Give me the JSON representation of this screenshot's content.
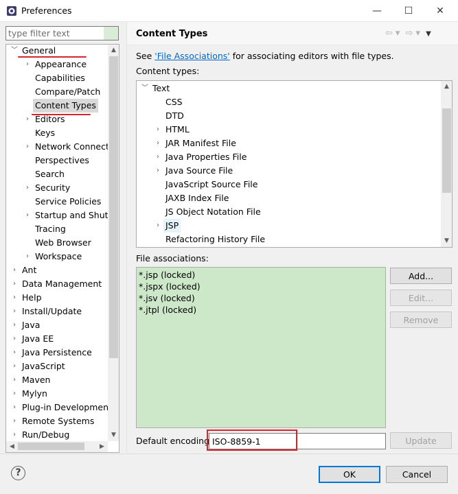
{
  "window": {
    "title": "Preferences",
    "min_glyph": "—",
    "max_glyph": "☐",
    "close_glyph": "✕"
  },
  "filter": {
    "placeholder": "type filter text"
  },
  "tree": {
    "items": [
      {
        "label": "General",
        "chevron": "﹀"
      },
      {
        "label": "Appearance",
        "chevron": "›"
      },
      {
        "label": "Capabilities"
      },
      {
        "label": "Compare/Patch"
      },
      {
        "label": "Content Types"
      },
      {
        "label": "Editors",
        "chevron": "›"
      },
      {
        "label": "Keys"
      },
      {
        "label": "Network Connectio",
        "chevron": "›"
      },
      {
        "label": "Perspectives"
      },
      {
        "label": "Search"
      },
      {
        "label": "Security",
        "chevron": "›"
      },
      {
        "label": "Service Policies"
      },
      {
        "label": "Startup and Shutd",
        "chevron": "›"
      },
      {
        "label": "Tracing"
      },
      {
        "label": "Web Browser"
      },
      {
        "label": "Workspace",
        "chevron": "›"
      },
      {
        "label": "Ant",
        "chevron": "›"
      },
      {
        "label": "Data Management",
        "chevron": "›"
      },
      {
        "label": "Help",
        "chevron": "›"
      },
      {
        "label": "Install/Update",
        "chevron": "›"
      },
      {
        "label": "Java",
        "chevron": "›"
      },
      {
        "label": "Java EE",
        "chevron": "›"
      },
      {
        "label": "Java Persistence",
        "chevron": "›"
      },
      {
        "label": "JavaScript",
        "chevron": "›"
      },
      {
        "label": "Maven",
        "chevron": "›"
      },
      {
        "label": "Mylyn",
        "chevron": "›"
      },
      {
        "label": "Plug-in Development",
        "chevron": "›"
      },
      {
        "label": "Remote Systems",
        "chevron": "›"
      },
      {
        "label": "Run/Debug",
        "chevron": "›"
      }
    ]
  },
  "page": {
    "title": "Content Types",
    "nav_back": "⇦",
    "nav_forward": "⇨",
    "nav_dropdown": "▾",
    "nav_menu": "▼"
  },
  "see": {
    "prefix": "See ",
    "link": "'File Associations'",
    "suffix": " for associating editors with file types."
  },
  "content_types": {
    "label": "Content types:",
    "items": [
      {
        "label": "Text",
        "chevron": "﹀"
      },
      {
        "label": "CSS"
      },
      {
        "label": "DTD"
      },
      {
        "label": "HTML",
        "chevron": "›"
      },
      {
        "label": "JAR Manifest File",
        "chevron": "›"
      },
      {
        "label": "Java Properties File",
        "chevron": "›"
      },
      {
        "label": "Java Source File",
        "chevron": "›"
      },
      {
        "label": "JavaScript Source File"
      },
      {
        "label": "JAXB Index File"
      },
      {
        "label": "JS Object Notation File"
      },
      {
        "label": "JSP",
        "chevron": "›"
      },
      {
        "label": "Refactoring History File"
      }
    ]
  },
  "file_associations": {
    "label": "File associations:",
    "items": [
      "*.jsp (locked)",
      "*.jspx (locked)",
      "*.jsv (locked)",
      "*.jtpl (locked)"
    ],
    "add": "Add...",
    "edit": "Edit...",
    "remove": "Remove"
  },
  "encoding": {
    "label": "Default encoding:",
    "value": "ISO-8859-1",
    "update": "Update"
  },
  "footer": {
    "help_glyph": "?",
    "ok": "OK",
    "cancel": "Cancel"
  },
  "colors": {
    "annotation_red": "#d8242a",
    "link_blue": "#0066cc",
    "association_bg": "#cde8c9"
  }
}
